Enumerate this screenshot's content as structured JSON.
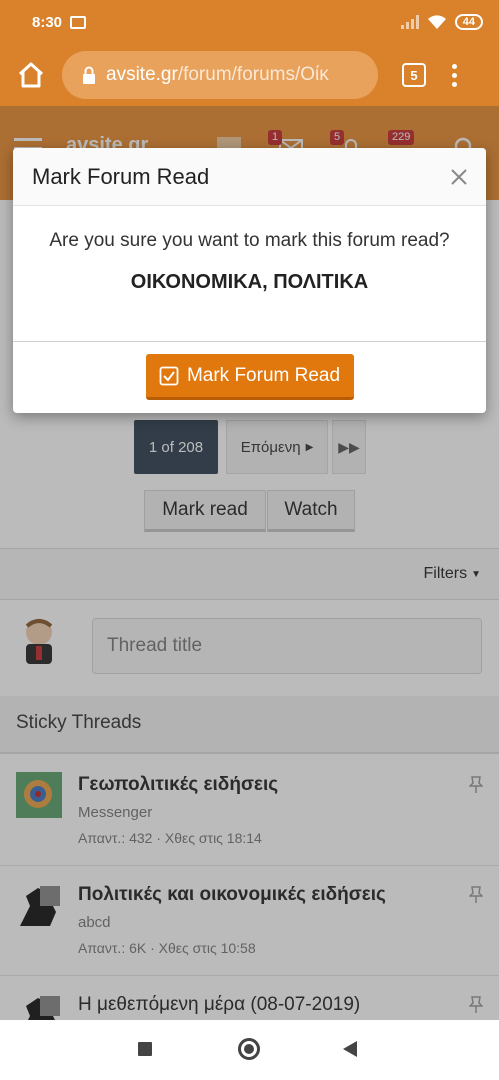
{
  "status_bar": {
    "time": "8:30",
    "battery": "44"
  },
  "browser": {
    "url_host": "avsite.gr",
    "url_path": "/forum/forums/Οίκ",
    "tab_count": "5"
  },
  "site_header": {
    "logo_text": "avsite.gr",
    "badges": {
      "inbox": "1",
      "alerts": "5",
      "notifications": "229"
    }
  },
  "modal": {
    "title": "Mark Forum Read",
    "question": "Are you sure you want to mark this forum read?",
    "forum_name": "ΟΙΚΟΝΟΜΙΚΑ, ΠΟΛΙΤΙΚΑ",
    "confirm_label": "Mark Forum Read"
  },
  "pagination": {
    "current": "1 of 208",
    "next_label": "Επόμενη"
  },
  "actions": {
    "mark_read": "Mark read",
    "watch": "Watch"
  },
  "filters_label": "Filters",
  "new_thread": {
    "placeholder": "Thread title"
  },
  "sticky_header": "Sticky Threads",
  "threads": [
    {
      "title": "Γεωπολιτικές ειδήσεις",
      "author": "Messenger",
      "meta": "Απαντ.: 432 · Χθες στις 18:14"
    },
    {
      "title": "Πολιτικές και οικονομικές ειδήσεις",
      "author": "abcd",
      "meta": "Απαντ.: 6K · Χθες στις 10:58"
    },
    {
      "title": "Η μεθεπόμενη μέρα (08-07-2019)",
      "author": "",
      "meta": ""
    }
  ],
  "colors": {
    "accent": "#e0780e",
    "browser_bar": "#d9822b",
    "pager_active": "#2d3e50"
  }
}
